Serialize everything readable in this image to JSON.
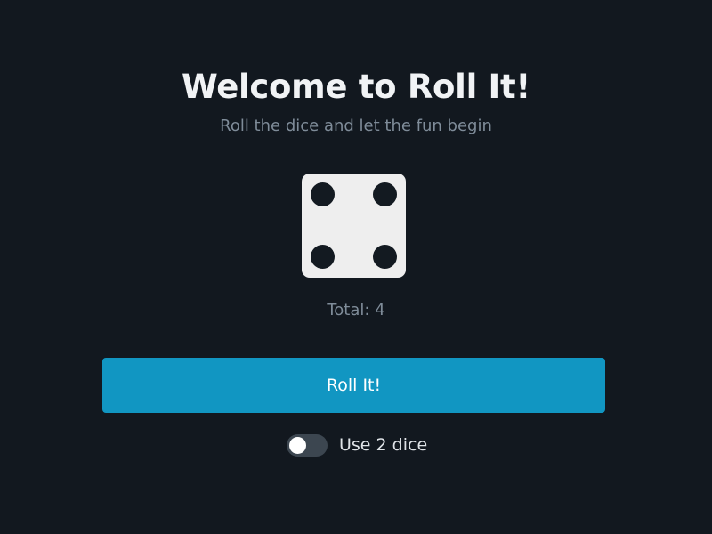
{
  "header": {
    "title": "Welcome to Roll It!",
    "subtitle": "Roll the dice and let the fun begin"
  },
  "die": {
    "value": 4,
    "face_color": "#eeeeee",
    "pip_color": "#131a21"
  },
  "result": {
    "total_text": "Total: 4"
  },
  "actions": {
    "roll_label": "Roll It!",
    "accent": "#1196c2"
  },
  "options": {
    "two_dice_label": "Use 2 dice",
    "two_dice_enabled": false
  }
}
